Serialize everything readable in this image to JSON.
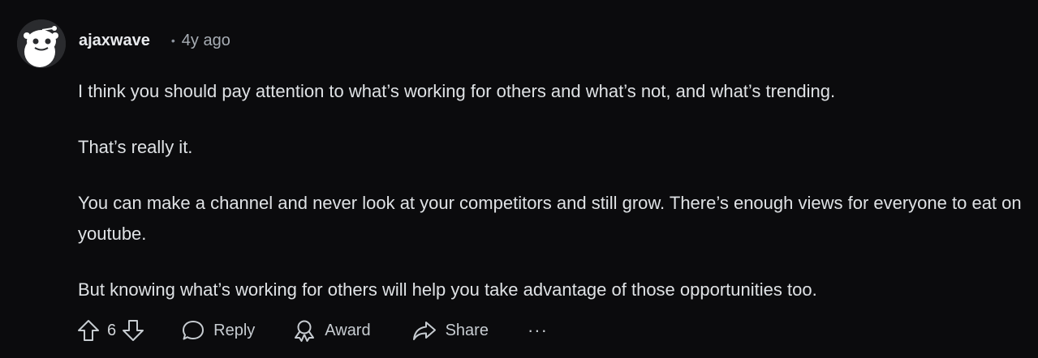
{
  "comment": {
    "author": "ajaxwave",
    "separator": "•",
    "time": "4y ago",
    "paragraphs": [
      "I think you should pay attention to what’s working for others and what’s not, and what’s trending.",
      "That’s really it.",
      "You can make a channel and never look at your competitors and still grow. There’s enough views for everyone to eat on youtube.",
      "But knowing what’s working for others will help you take advantage of those opportunities too."
    ],
    "score": "6",
    "actions": {
      "reply": "Reply",
      "award": "Award",
      "share": "Share",
      "more": "···"
    },
    "icons": {
      "avatar": "snoo-avatar-icon",
      "upvote": "arrow-up-icon",
      "downvote": "arrow-down-icon",
      "reply": "speech-bubble-icon",
      "award": "award-ribbon-icon",
      "share": "share-arrow-icon"
    },
    "colors": {
      "background": "#0b0b0d",
      "text": "#dfe2e5",
      "muted": "#a7adb4"
    }
  }
}
